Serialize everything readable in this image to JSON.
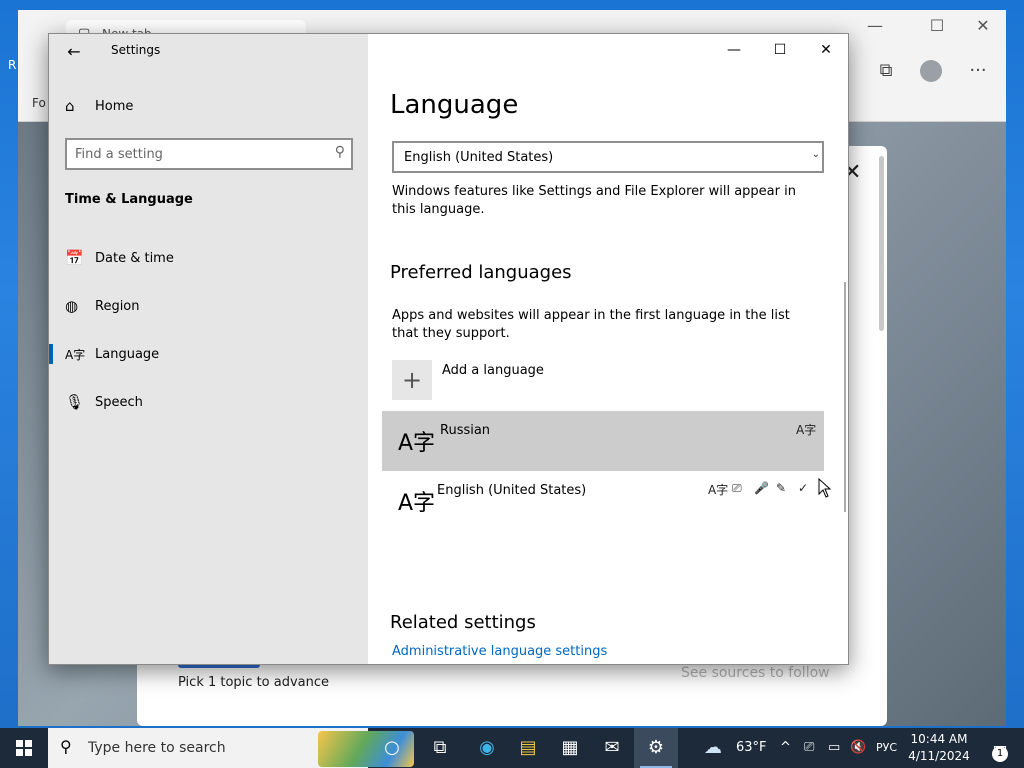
{
  "desktop": {
    "edge_text": "R"
  },
  "browser": {
    "tab_label": "New tab",
    "left_text": "Fo",
    "win_min": "—",
    "win_max": "☐",
    "win_close": "✕",
    "tools": {
      "collections": "⧉",
      "more": "···"
    }
  },
  "background_dialog": {
    "close": "✕",
    "pick_text": "Pick 1 topic to advance",
    "sources_text": "See sources to follow"
  },
  "settings": {
    "title": "Settings",
    "back_icon": "←",
    "home_label": "Home",
    "search_placeholder": "Find a setting",
    "section": "Time & Language",
    "nav_items": [
      {
        "label": "Date & time",
        "icon": "📅"
      },
      {
        "label": "Region",
        "icon": "◍"
      },
      {
        "label": "Language",
        "icon": "A字"
      },
      {
        "label": "Speech",
        "icon": "🎙"
      }
    ],
    "controls": {
      "minimize": "—",
      "maximize": "☐",
      "close": "✕"
    },
    "main": {
      "title": "Language",
      "display_language": "English (United States)",
      "display_desc": "Windows features like Settings and File Explorer will appear in this language.",
      "preferred_title": "Preferred languages",
      "preferred_desc": "Apps and websites will appear in the first language in the list that they support.",
      "add_icon": "+",
      "add_label": "Add a language",
      "languages": [
        {
          "name": "Russian",
          "glyph": "A字",
          "features": [
            "A字"
          ]
        },
        {
          "name": "English (United States)",
          "glyph": "A字",
          "features": [
            "A字",
            "⎚",
            "🎤",
            "✎",
            "✓"
          ]
        }
      ],
      "related_title": "Related settings",
      "related_link": "Administrative language settings"
    }
  },
  "taskbar": {
    "search_placeholder": "Type here to search",
    "weather": "63°F",
    "ime": "РУС",
    "time": "10:44 AM",
    "date": "4/11/2024",
    "notif_count": "1",
    "icons": {
      "cortana": "○",
      "taskview": "⧉",
      "edge": "◉",
      "explorer": "▤",
      "store": "▦",
      "mail": "✉",
      "settings": "⚙",
      "weather": "☁",
      "chevron": "^",
      "network": "▭",
      "volume": "🔇"
    }
  }
}
